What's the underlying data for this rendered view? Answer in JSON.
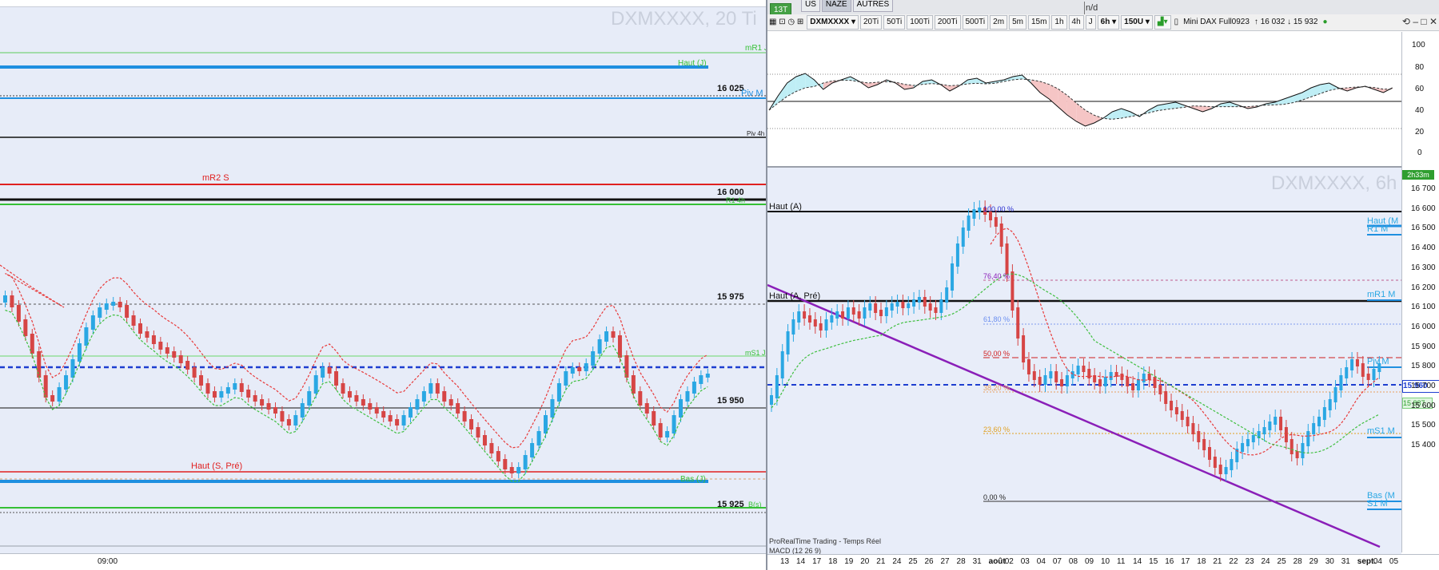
{
  "left_chart": {
    "watermark": "DXMXXXX, 20 Ti",
    "x_tick": "09:00",
    "price_labels": [
      "16 025",
      "16 000",
      "15 975",
      "15 950",
      "15 925"
    ],
    "line_labels": {
      "mr1j": "mR1 J",
      "haut_j": "Haut (J)",
      "piv_m": "Piv M",
      "piv_4h": "Piv 4h",
      "mr2_s": "mR2 S",
      "r1_4h": "R1 4h",
      "ms1_j": "mS1 J",
      "haut_s_pre": "Haut (S, Pré)",
      "bas_j": "Bas (J)",
      "bas_s": "B(s)"
    }
  },
  "right_panel": {
    "tabs": [
      "US",
      "NAZE",
      "AUTRES"
    ],
    "selected_tab": "NAZE",
    "small_badge": "13T",
    "toolbar": {
      "symbol": "DXMXXXX",
      "periods": [
        "20Ti",
        "50Ti",
        "100Ti",
        "200Ti",
        "500Ti",
        "2m",
        "5m",
        "15m",
        "1h",
        "4h",
        "J"
      ],
      "timeframe": "6h",
      "units": "150U",
      "instrument": "Mini DAX Full0923",
      "prices": "↑ 16 032 ↓ 15 932"
    },
    "osc_axis": [
      "100",
      "80",
      "60",
      "40",
      "20",
      "0"
    ],
    "timer": "2h33m",
    "main_watermark": "DXMXXXX, 6h",
    "main_axis": [
      "16 700",
      "16 600",
      "16 500",
      "16 400",
      "16 300",
      "16 200",
      "16 100",
      "16 000",
      "15 900",
      "15 800",
      "15 700",
      "15 600",
      "15 500",
      "15 400"
    ],
    "last_price": "15 960",
    "green_price": "15 887",
    "hline_labels": {
      "haut_a": "Haut (A)",
      "haut_a_pre": "Haut (A, Pré)"
    },
    "fib_labels": [
      "100,00 %",
      "76,40 %",
      "61,80 %",
      "50,00 %",
      "38,20 %",
      "23,60 %",
      "0,00 %"
    ],
    "right_labels": [
      "Haut (M",
      "R1 M",
      "mR1 M",
      "Piv M",
      "mS1 M",
      "Bas (M",
      "S1 M"
    ],
    "footer": "ProRealTime Trading - Temps Réel",
    "macd": "MACD (12 26 9)",
    "x_labels": [
      "13",
      "14",
      "17",
      "18",
      "19",
      "20",
      "21",
      "24",
      "25",
      "26",
      "27",
      "28",
      "31",
      "août",
      "02",
      "03",
      "04",
      "07",
      "08",
      "09",
      "10",
      "11",
      "14",
      "15",
      "16",
      "17",
      "18",
      "21",
      "22",
      "23",
      "24",
      "25",
      "28",
      "29",
      "30",
      "31",
      "sept.",
      "04",
      "05"
    ],
    "top_fragment": "n/d"
  },
  "colors": {
    "bull": "#2aa7e3",
    "bear": "#d64545",
    "pivot_blue": "#1f8fe0",
    "resistance_red": "#e02020",
    "support_green": "#35c035",
    "trend_purple": "#8a1fb8",
    "dashed_blue": "#1e3fd0"
  }
}
